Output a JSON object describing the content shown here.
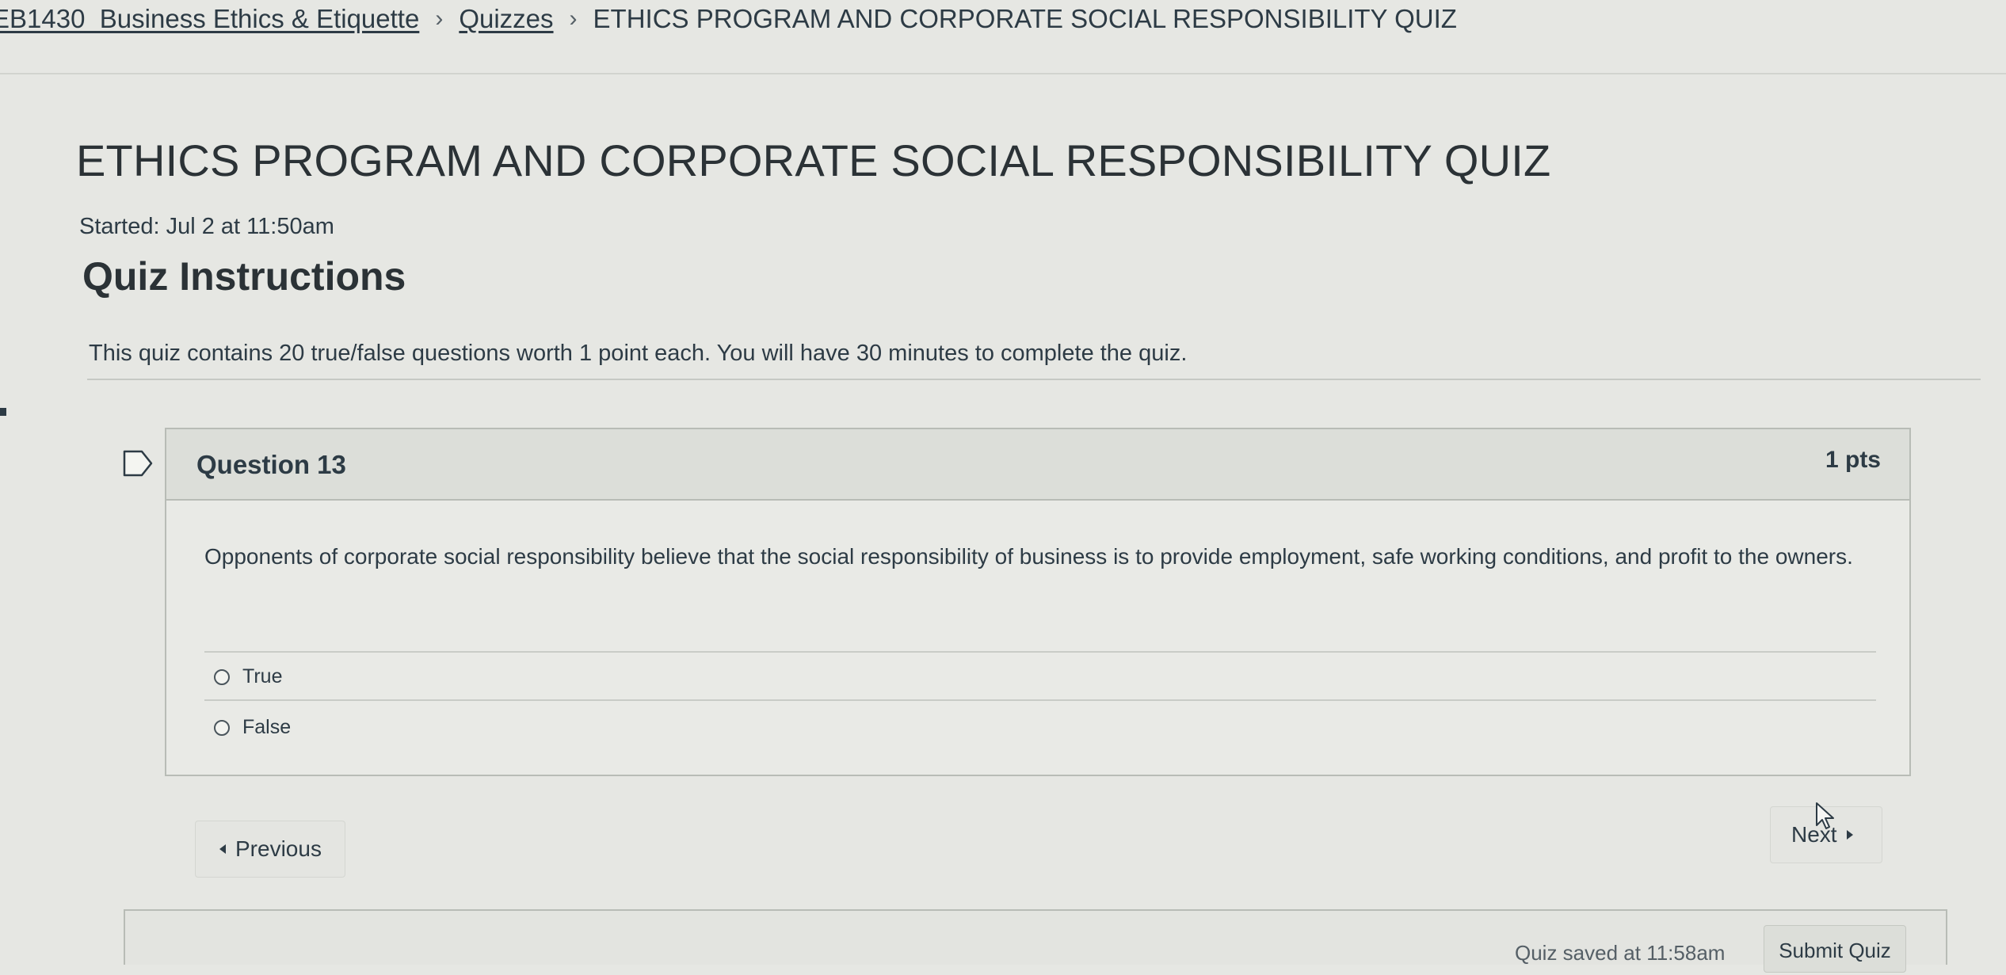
{
  "breadcrumb": {
    "course": "EB1430_Business Ethics & Etiquette",
    "quizzes": "Quizzes",
    "current": "ETHICS PROGRAM AND CORPORATE SOCIAL RESPONSIBILITY QUIZ",
    "separator": "›"
  },
  "quiz": {
    "title": "ETHICS PROGRAM AND CORPORATE SOCIAL RESPONSIBILITY QUIZ",
    "started": "Started: Jul 2 at 11:50am",
    "instructions_heading": "Quiz Instructions",
    "instructions_text": "This quiz contains 20 true/false questions worth 1 point each. You will have 30 minutes to complete the quiz."
  },
  "question": {
    "title": "Question 13",
    "points": "1 pts",
    "text": "Opponents of corporate social responsibility believe that the social responsibility of business is to provide employment, safe working conditions, and profit to the owners.",
    "answers": [
      {
        "label": "True",
        "selected": false
      },
      {
        "label": "False",
        "selected": false
      }
    ]
  },
  "navigation": {
    "previous_label": "Previous",
    "next_label": "Next"
  },
  "footer": {
    "saved_text": "Quiz saved at 11:58am",
    "submit_label": "Submit Quiz"
  },
  "icons": {
    "flag": "flag-icon",
    "previous": "triangle-left-icon",
    "next": "triangle-right-icon",
    "cursor": "mouse-cursor-icon"
  },
  "colors": {
    "background": "#e6e7e3",
    "text": "#2d3b45",
    "card_header": "#dcded9",
    "border": "#b8bcb6"
  }
}
